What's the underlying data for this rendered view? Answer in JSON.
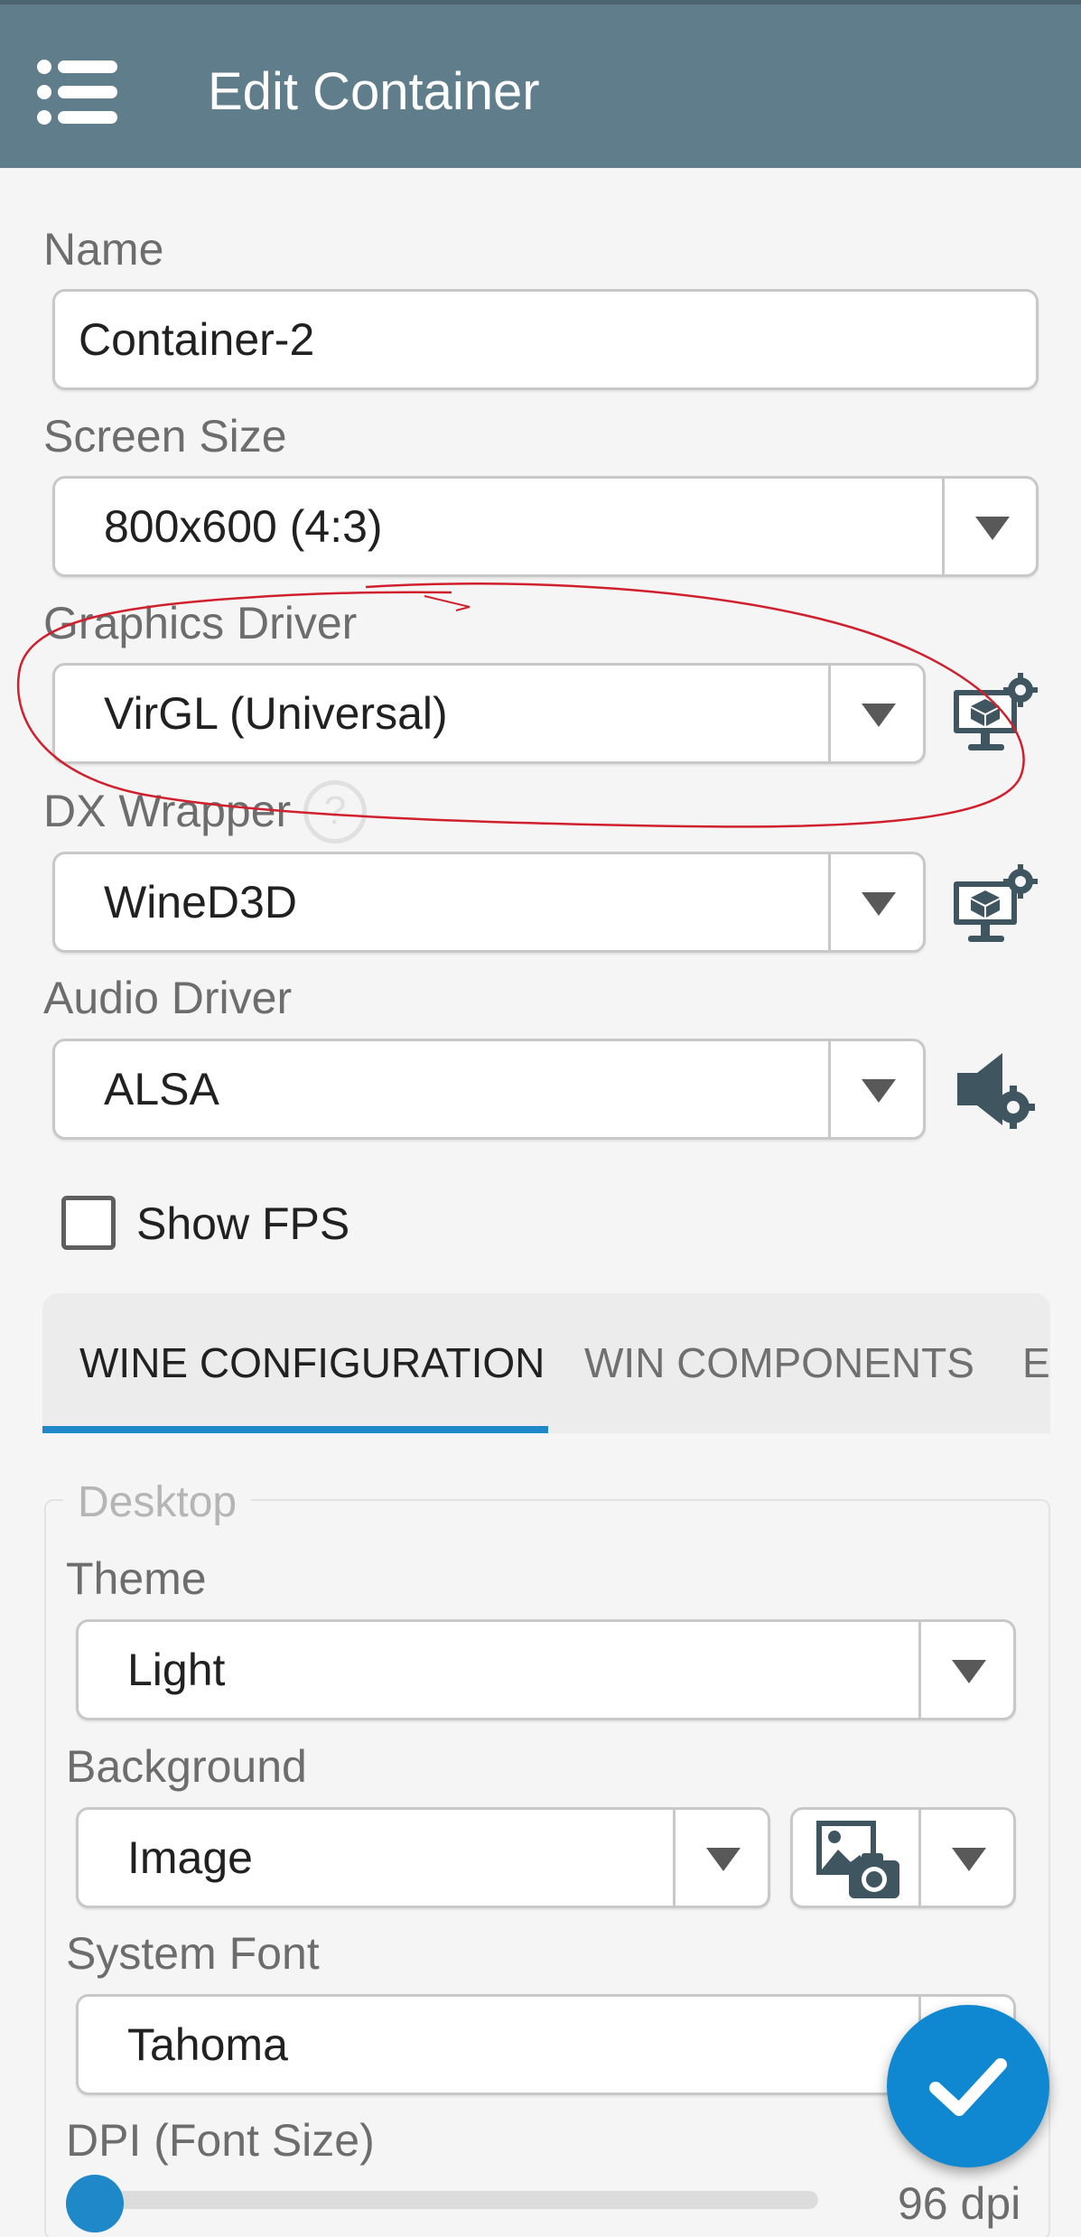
{
  "header": {
    "title": "Edit Container",
    "menu_icon": "menu-icon"
  },
  "name_field": {
    "label": "Name",
    "value": "Container-2"
  },
  "screen_size": {
    "label": "Screen Size",
    "value": "800x600 (4:3)"
  },
  "graphics_driver": {
    "label": "Graphics Driver",
    "value": "VirGL (Universal)",
    "settings_icon": "graphics-settings-icon"
  },
  "dx_wrapper": {
    "label": "DX Wrapper",
    "help": "?",
    "value": "WineD3D",
    "settings_icon": "dx-settings-icon"
  },
  "audio_driver": {
    "label": "Audio Driver",
    "value": "ALSA",
    "settings_icon": "audio-settings-icon"
  },
  "show_fps": {
    "label": "Show FPS",
    "checked": false
  },
  "tabs": [
    {
      "label": "WINE CONFIGURATION",
      "active": true
    },
    {
      "label": "WIN COMPONENTS",
      "active": false
    },
    {
      "label": "EI",
      "active": false
    }
  ],
  "desktop": {
    "legend": "Desktop",
    "theme": {
      "label": "Theme",
      "value": "Light"
    },
    "background": {
      "label": "Background",
      "value": "Image",
      "image_icon": "image-camera-icon"
    },
    "system_font": {
      "label": "System Font",
      "value": "Tahoma"
    },
    "dpi": {
      "label": "DPI (Font Size)",
      "value_text": "96 dpi",
      "slider_fraction": 0.0
    }
  },
  "fab": {
    "icon": "checkmark-icon"
  },
  "colors": {
    "header": "#607d8b",
    "accent": "#1e88c8",
    "fab": "#0f88d1",
    "annotation": "#d0202e"
  }
}
